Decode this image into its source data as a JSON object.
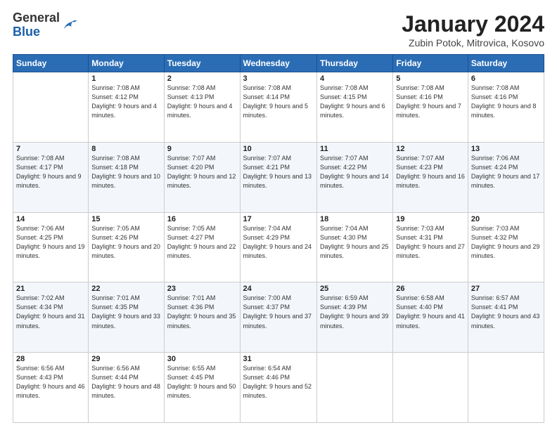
{
  "logo": {
    "general": "General",
    "blue": "Blue"
  },
  "title": "January 2024",
  "subtitle": "Zubin Potok, Mitrovica, Kosovo",
  "days_header": [
    "Sunday",
    "Monday",
    "Tuesday",
    "Wednesday",
    "Thursday",
    "Friday",
    "Saturday"
  ],
  "weeks": [
    [
      {
        "num": "",
        "sunrise": "",
        "sunset": "",
        "daylight": ""
      },
      {
        "num": "1",
        "sunrise": "Sunrise: 7:08 AM",
        "sunset": "Sunset: 4:12 PM",
        "daylight": "Daylight: 9 hours and 4 minutes."
      },
      {
        "num": "2",
        "sunrise": "Sunrise: 7:08 AM",
        "sunset": "Sunset: 4:13 PM",
        "daylight": "Daylight: 9 hours and 4 minutes."
      },
      {
        "num": "3",
        "sunrise": "Sunrise: 7:08 AM",
        "sunset": "Sunset: 4:14 PM",
        "daylight": "Daylight: 9 hours and 5 minutes."
      },
      {
        "num": "4",
        "sunrise": "Sunrise: 7:08 AM",
        "sunset": "Sunset: 4:15 PM",
        "daylight": "Daylight: 9 hours and 6 minutes."
      },
      {
        "num": "5",
        "sunrise": "Sunrise: 7:08 AM",
        "sunset": "Sunset: 4:16 PM",
        "daylight": "Daylight: 9 hours and 7 minutes."
      },
      {
        "num": "6",
        "sunrise": "Sunrise: 7:08 AM",
        "sunset": "Sunset: 4:16 PM",
        "daylight": "Daylight: 9 hours and 8 minutes."
      }
    ],
    [
      {
        "num": "7",
        "sunrise": "Sunrise: 7:08 AM",
        "sunset": "Sunset: 4:17 PM",
        "daylight": "Daylight: 9 hours and 9 minutes."
      },
      {
        "num": "8",
        "sunrise": "Sunrise: 7:08 AM",
        "sunset": "Sunset: 4:18 PM",
        "daylight": "Daylight: 9 hours and 10 minutes."
      },
      {
        "num": "9",
        "sunrise": "Sunrise: 7:07 AM",
        "sunset": "Sunset: 4:20 PM",
        "daylight": "Daylight: 9 hours and 12 minutes."
      },
      {
        "num": "10",
        "sunrise": "Sunrise: 7:07 AM",
        "sunset": "Sunset: 4:21 PM",
        "daylight": "Daylight: 9 hours and 13 minutes."
      },
      {
        "num": "11",
        "sunrise": "Sunrise: 7:07 AM",
        "sunset": "Sunset: 4:22 PM",
        "daylight": "Daylight: 9 hours and 14 minutes."
      },
      {
        "num": "12",
        "sunrise": "Sunrise: 7:07 AM",
        "sunset": "Sunset: 4:23 PM",
        "daylight": "Daylight: 9 hours and 16 minutes."
      },
      {
        "num": "13",
        "sunrise": "Sunrise: 7:06 AM",
        "sunset": "Sunset: 4:24 PM",
        "daylight": "Daylight: 9 hours and 17 minutes."
      }
    ],
    [
      {
        "num": "14",
        "sunrise": "Sunrise: 7:06 AM",
        "sunset": "Sunset: 4:25 PM",
        "daylight": "Daylight: 9 hours and 19 minutes."
      },
      {
        "num": "15",
        "sunrise": "Sunrise: 7:05 AM",
        "sunset": "Sunset: 4:26 PM",
        "daylight": "Daylight: 9 hours and 20 minutes."
      },
      {
        "num": "16",
        "sunrise": "Sunrise: 7:05 AM",
        "sunset": "Sunset: 4:27 PM",
        "daylight": "Daylight: 9 hours and 22 minutes."
      },
      {
        "num": "17",
        "sunrise": "Sunrise: 7:04 AM",
        "sunset": "Sunset: 4:29 PM",
        "daylight": "Daylight: 9 hours and 24 minutes."
      },
      {
        "num": "18",
        "sunrise": "Sunrise: 7:04 AM",
        "sunset": "Sunset: 4:30 PM",
        "daylight": "Daylight: 9 hours and 25 minutes."
      },
      {
        "num": "19",
        "sunrise": "Sunrise: 7:03 AM",
        "sunset": "Sunset: 4:31 PM",
        "daylight": "Daylight: 9 hours and 27 minutes."
      },
      {
        "num": "20",
        "sunrise": "Sunrise: 7:03 AM",
        "sunset": "Sunset: 4:32 PM",
        "daylight": "Daylight: 9 hours and 29 minutes."
      }
    ],
    [
      {
        "num": "21",
        "sunrise": "Sunrise: 7:02 AM",
        "sunset": "Sunset: 4:34 PM",
        "daylight": "Daylight: 9 hours and 31 minutes."
      },
      {
        "num": "22",
        "sunrise": "Sunrise: 7:01 AM",
        "sunset": "Sunset: 4:35 PM",
        "daylight": "Daylight: 9 hours and 33 minutes."
      },
      {
        "num": "23",
        "sunrise": "Sunrise: 7:01 AM",
        "sunset": "Sunset: 4:36 PM",
        "daylight": "Daylight: 9 hours and 35 minutes."
      },
      {
        "num": "24",
        "sunrise": "Sunrise: 7:00 AM",
        "sunset": "Sunset: 4:37 PM",
        "daylight": "Daylight: 9 hours and 37 minutes."
      },
      {
        "num": "25",
        "sunrise": "Sunrise: 6:59 AM",
        "sunset": "Sunset: 4:39 PM",
        "daylight": "Daylight: 9 hours and 39 minutes."
      },
      {
        "num": "26",
        "sunrise": "Sunrise: 6:58 AM",
        "sunset": "Sunset: 4:40 PM",
        "daylight": "Daylight: 9 hours and 41 minutes."
      },
      {
        "num": "27",
        "sunrise": "Sunrise: 6:57 AM",
        "sunset": "Sunset: 4:41 PM",
        "daylight": "Daylight: 9 hours and 43 minutes."
      }
    ],
    [
      {
        "num": "28",
        "sunrise": "Sunrise: 6:56 AM",
        "sunset": "Sunset: 4:43 PM",
        "daylight": "Daylight: 9 hours and 46 minutes."
      },
      {
        "num": "29",
        "sunrise": "Sunrise: 6:56 AM",
        "sunset": "Sunset: 4:44 PM",
        "daylight": "Daylight: 9 hours and 48 minutes."
      },
      {
        "num": "30",
        "sunrise": "Sunrise: 6:55 AM",
        "sunset": "Sunset: 4:45 PM",
        "daylight": "Daylight: 9 hours and 50 minutes."
      },
      {
        "num": "31",
        "sunrise": "Sunrise: 6:54 AM",
        "sunset": "Sunset: 4:46 PM",
        "daylight": "Daylight: 9 hours and 52 minutes."
      },
      {
        "num": "",
        "sunrise": "",
        "sunset": "",
        "daylight": ""
      },
      {
        "num": "",
        "sunrise": "",
        "sunset": "",
        "daylight": ""
      },
      {
        "num": "",
        "sunrise": "",
        "sunset": "",
        "daylight": ""
      }
    ]
  ]
}
